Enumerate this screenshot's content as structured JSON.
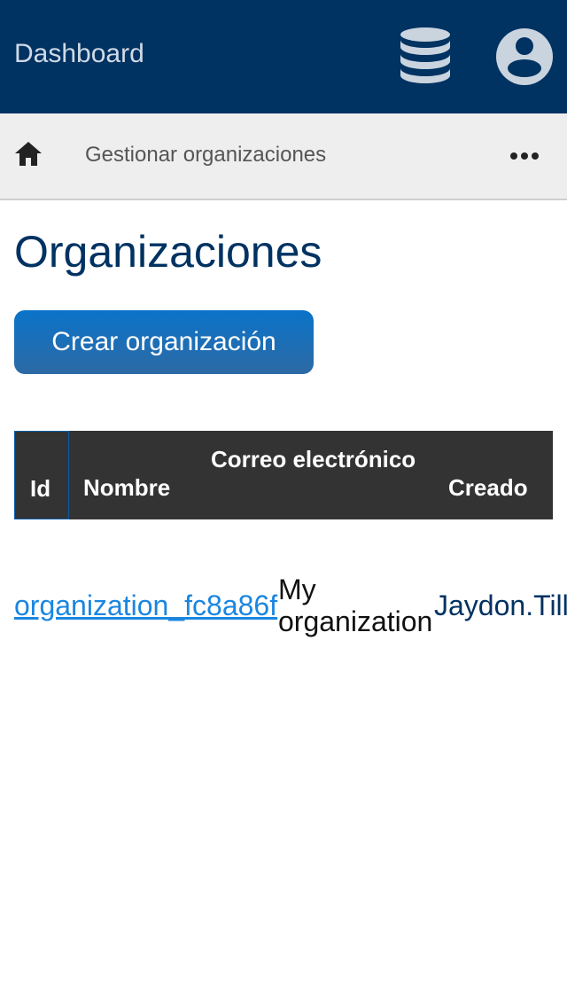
{
  "header": {
    "app_title": "Dashboard",
    "database_icon": "database-icon",
    "account_icon": "account-circle-icon"
  },
  "breadcrumb": {
    "home_icon": "home-icon",
    "current": "Gestionar organizaciones",
    "more_icon": "more-horizontal-icon"
  },
  "page": {
    "title": "Organizaciones",
    "create_button": "Crear organización"
  },
  "table": {
    "columns": [
      "Id",
      "Nombre",
      "Correo electrónico",
      "Creado"
    ],
    "rows": [
      {
        "id": "organization_fc8a86f",
        "name": "My organization",
        "email": "Jaydon.Till"
      }
    ]
  },
  "colors": {
    "header_bg": "#003262",
    "breadcrumb_bg": "#eeeeee",
    "accent": "#0a73c9",
    "link": "#1a86e0",
    "table_header_bg": "#333333"
  }
}
